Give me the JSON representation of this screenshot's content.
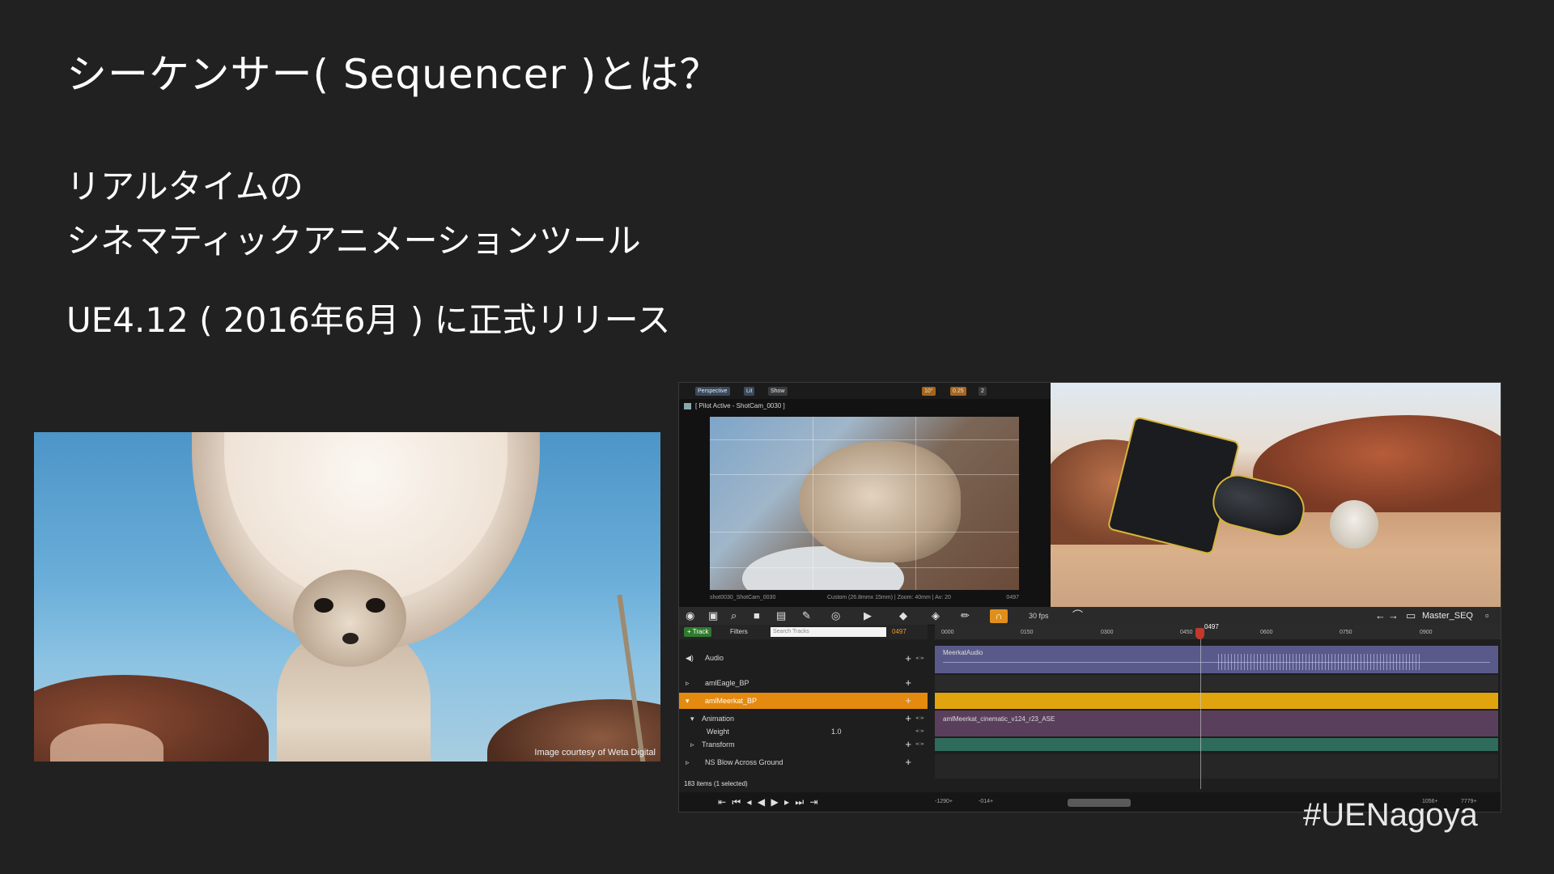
{
  "slide": {
    "title": "シーケンサー( Sequencer )とは？",
    "line1": "リアルタイムの",
    "line2": "シネマティックアニメーションツール",
    "line3": "UE4.12 ( 2016年6月 ) に正式リリース",
    "hashtag": "#UENagoya"
  },
  "photo": {
    "credit": "Image courtesy of Weta Digital"
  },
  "viewport": {
    "chips": [
      "Perspective",
      "Lit",
      "Show",
      "10°",
      "0.25",
      "2"
    ],
    "pilot_label": "[ Pilot Active - ShotCam_0030 ]",
    "foot_left": "shot0030_ShotCam_0030",
    "foot_mid": "Custom (26.8mmx 15mm) | Zoom: 40mm | Av: 20",
    "foot_right": "0497"
  },
  "sequencer": {
    "fps": "30 fps",
    "master": "Master_SEQ",
    "track_button": "+ Track",
    "filters": "Filters",
    "search_placeholder": "Search Tracks",
    "current_frame": "0497",
    "playhead_label": "0497",
    "ruler": [
      "0000",
      "0150",
      "0300",
      "0450",
      "0600",
      "0750",
      "0900"
    ],
    "tracks": {
      "audio": "Audio",
      "eagle": "amlEagle_BP",
      "meerkat": "amlMeerkat_BP",
      "animation": "Animation",
      "weight": "Weight",
      "weight_value": "1.0",
      "transform": "Transform",
      "ns": "NS Blow Across Ground"
    },
    "audio_clip": "MeerkatAudio",
    "anim_clip": "amlMeerkat_cinematic_v124_r23_ASE",
    "items_count": "183 items (1 selected)",
    "foot_numbers": [
      "-1290+",
      "-014+",
      "1056+",
      "7779+"
    ]
  },
  "colors": {
    "background": "#212121",
    "audio_lane": "#5a5a8a",
    "meerkat_row": "#e38a0f",
    "meerkat_lane": "#e0a40e",
    "anim_lane": "#5a3f5c",
    "transform_lane": "#2f6b5b"
  }
}
